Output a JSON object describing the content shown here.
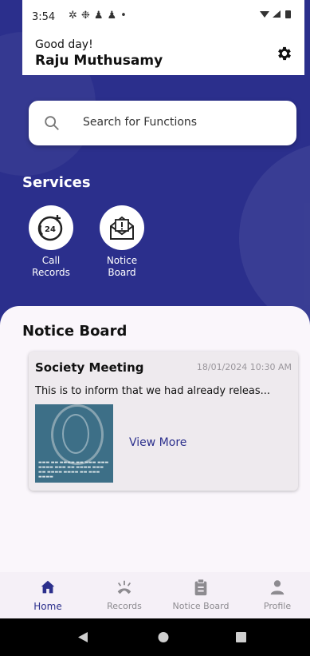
{
  "status_bar": {
    "time": "3:54",
    "left_icons": [
      "gear-icon",
      "fan-icon",
      "person-icon",
      "person-icon",
      "dot-icon"
    ],
    "right_icons": [
      "wifi-icon",
      "signal-icon",
      "battery-icon"
    ]
  },
  "header": {
    "greeting": "Good day!",
    "user_name": "Raju Muthusamy"
  },
  "search": {
    "placeholder": "Search for Functions"
  },
  "services": {
    "title": "Services",
    "items": [
      {
        "label_line1": "Call",
        "label_line2": "Records",
        "icon": "24h-phone-icon"
      },
      {
        "label_line1": "Notice",
        "label_line2": "Board",
        "icon": "envelope-alert-icon"
      }
    ]
  },
  "notice_board": {
    "title": "Notice Board",
    "cards": [
      {
        "title": "Society Meeting",
        "date": "18/01/2024 10:30 AM",
        "description": "This is to inform that we had already releas...",
        "link": "View More"
      }
    ]
  },
  "bottom_nav": {
    "items": [
      {
        "label": "Home",
        "icon": "home-icon",
        "active": true
      },
      {
        "label": "Records",
        "icon": "records-icon",
        "active": false
      },
      {
        "label": "Notice Board",
        "icon": "clipboard-icon",
        "active": false
      },
      {
        "label": "Profile",
        "icon": "profile-icon",
        "active": false
      }
    ]
  },
  "colors": {
    "primary": "#2b2f8c",
    "background": "#faf6fb"
  }
}
